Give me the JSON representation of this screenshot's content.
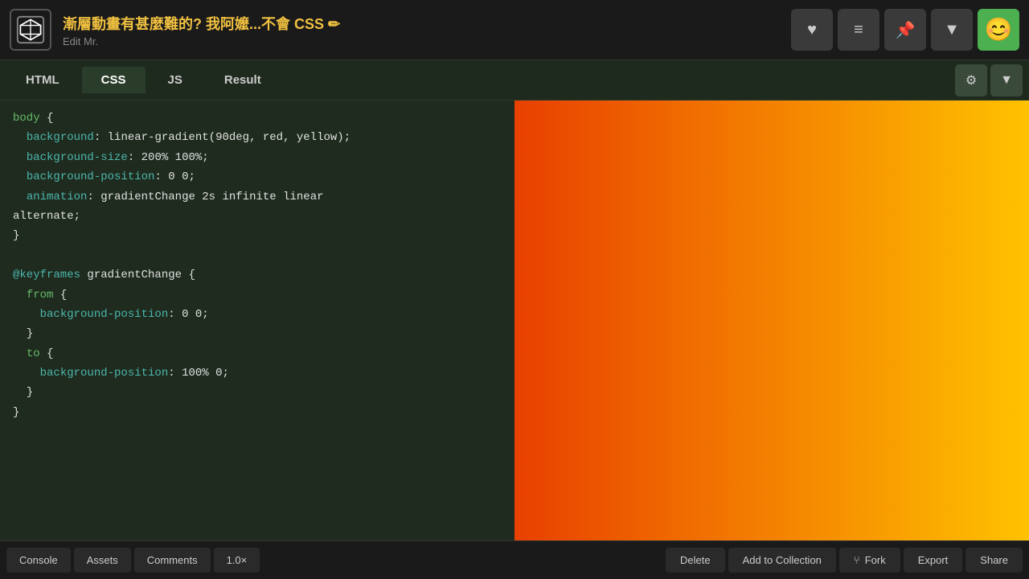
{
  "header": {
    "title": "漸層動畫有甚麼難的? 我阿嬤...不會 CSS ✏",
    "subtitle": "Edit Mr.",
    "pencil_char": "✏"
  },
  "tabs": {
    "items": [
      "HTML",
      "CSS",
      "JS",
      "Result"
    ],
    "active": 1
  },
  "code": {
    "lines": [
      {
        "text": "body {",
        "type": "selector-open"
      },
      {
        "text": "  background: linear-gradient(90deg, red, yellow);",
        "type": "property"
      },
      {
        "text": "  background-size: 200% 100%;",
        "type": "property"
      },
      {
        "text": "  background-position: 0 0;",
        "type": "property"
      },
      {
        "text": "  animation: gradientChange 2s infinite linear",
        "type": "property"
      },
      {
        "text": "alternate;",
        "type": "value-cont"
      },
      {
        "text": "}",
        "type": "close"
      },
      {
        "text": "",
        "type": "blank"
      },
      {
        "text": "@keyframes gradientChange {",
        "type": "atrule"
      },
      {
        "text": "  from {",
        "type": "keyword-open"
      },
      {
        "text": "    background-position: 0 0;",
        "type": "property"
      },
      {
        "text": "  }",
        "type": "close"
      },
      {
        "text": "  to {",
        "type": "keyword-open"
      },
      {
        "text": "    background-position: 100% 0;",
        "type": "property"
      },
      {
        "text": "  }",
        "type": "close"
      },
      {
        "text": "}",
        "type": "close"
      }
    ]
  },
  "bottom_bar": {
    "console": "Console",
    "assets": "Assets",
    "comments": "Comments",
    "zoom": "1.0×",
    "delete": "Delete",
    "add_to_collection": "Add to Collection",
    "fork": "Fork",
    "export": "Export",
    "share": "Share"
  }
}
